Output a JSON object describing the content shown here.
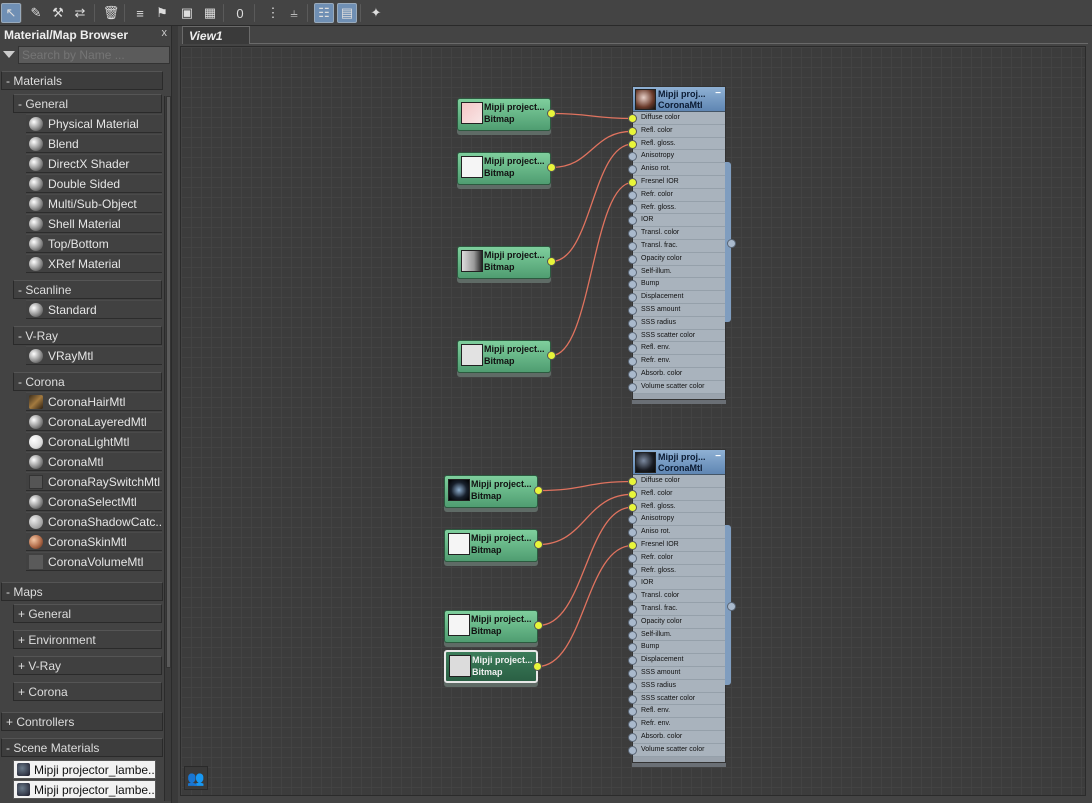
{
  "toolbar": {
    "icons": [
      "select-icon",
      "pick-material-icon",
      "eyedropper-icon",
      "layout-icon",
      "delete-icon",
      "move-children-icon",
      "select-children-icon",
      "show-background-icon",
      "checker-icon",
      "zero-icon",
      "layout-all-icon",
      "layout-children-icon",
      "navigator-icon",
      "parameter-editor-icon",
      "magic-icon"
    ]
  },
  "browser": {
    "title": "Material/Map Browser",
    "close": "x",
    "search_placeholder": "Search by Name ...",
    "materials_label": "- Materials",
    "groups": {
      "general": {
        "label": "- General",
        "items": [
          "Physical Material",
          "Blend",
          "DirectX Shader",
          "Double Sided",
          "Multi/Sub-Object",
          "Shell Material",
          "Top/Bottom",
          "XRef Material"
        ]
      },
      "scanline": {
        "label": "- Scanline",
        "items": [
          "Standard"
        ]
      },
      "vray": {
        "label": "- V-Ray",
        "items": [
          "VRayMtl"
        ]
      },
      "corona": {
        "label": "- Corona",
        "items": [
          "CoronaHairMtl",
          "CoronaLayeredMtl",
          "CoronaLightMtl",
          "CoronaMtl",
          "CoronaRaySwitchMtl",
          "CoronaSelectMtl",
          "CoronaShadowCatc...",
          "CoronaSkinMtl",
          "CoronaVolumeMtl"
        ]
      }
    },
    "maps": {
      "label": "- Maps",
      "items": [
        "+ General",
        "+ Environment",
        "+ V-Ray",
        "+ Corona"
      ]
    },
    "controllers_label": "+ Controllers",
    "scene_materials_label": "- Scene Materials",
    "scene_materials": [
      "Mipji projector_lambe...",
      "Mipji projector_lambe..."
    ]
  },
  "view": {
    "tab_label": "View1"
  },
  "nodes": {
    "bitmap_title": "Mipji project...",
    "bitmap_type": "Bitmap",
    "mtl_title": "Mipji proj...",
    "mtl_type": "CoronaMtl",
    "minimize": "−",
    "slots": [
      "Diffuse color",
      "Refl. color",
      "Refl. gloss.",
      "Anisotropy",
      "Aniso rot.",
      "Fresnel IOR",
      "Refr. color",
      "Refr. gloss.",
      "IOR",
      "Transl. color",
      "Transl. frac.",
      "Opacity color",
      "Self-illum.",
      "Bump",
      "Displacement",
      "SSS amount",
      "SSS radius",
      "SSS scatter color",
      "Refl. env.",
      "Refr. env.",
      "Absorb. color",
      "Volume scatter color"
    ]
  },
  "colors": {
    "wire": "#e0735f",
    "port_active": "#e8f53a",
    "bitmap_node": "#6bbd8c",
    "material_header": "#6f95c0"
  }
}
